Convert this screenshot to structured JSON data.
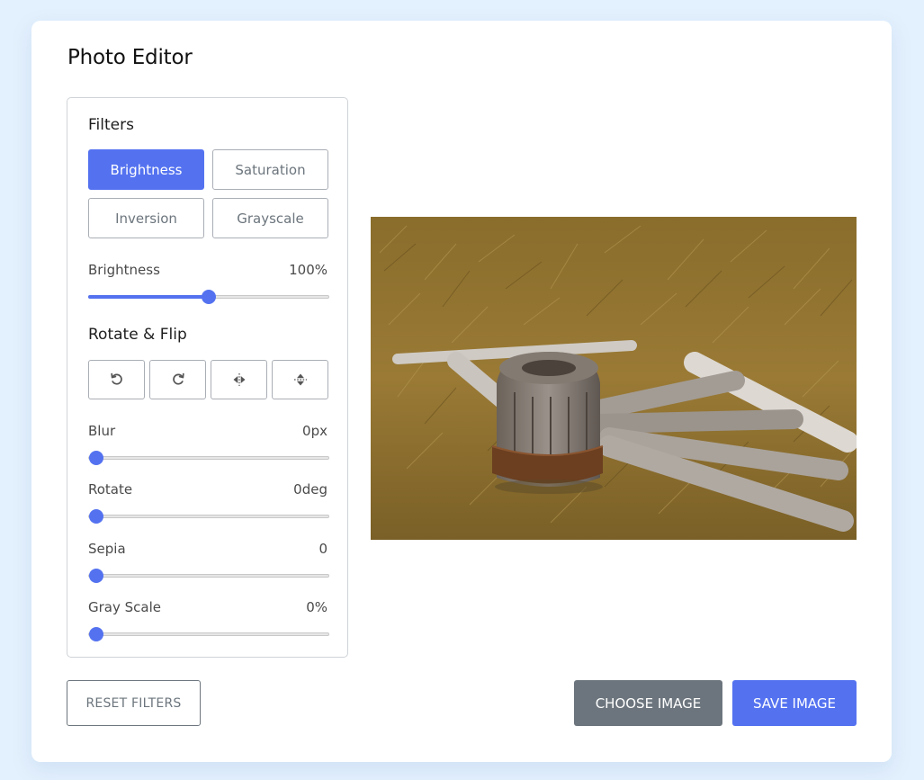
{
  "app": {
    "title": "Photo Editor"
  },
  "filters": {
    "heading": "Filters",
    "buttons": [
      {
        "label": "Brightness",
        "active": true
      },
      {
        "label": "Saturation",
        "active": false
      },
      {
        "label": "Inversion",
        "active": false
      },
      {
        "label": "Grayscale",
        "active": false
      }
    ],
    "active_slider": {
      "label": "Brightness",
      "value": "100%",
      "level_fraction": 0.5
    }
  },
  "rotate_flip": {
    "heading": "Rotate & Flip",
    "buttons": [
      "rotate-left-icon",
      "rotate-right-icon",
      "flip-horizontal-icon",
      "flip-vertical-icon"
    ]
  },
  "sliders": [
    {
      "label": "Blur",
      "value": "0px",
      "level_fraction": 0
    },
    {
      "label": "Rotate",
      "value": "0deg",
      "level_fraction": 0
    },
    {
      "label": "Sepia",
      "value": "0",
      "level_fraction": 0
    },
    {
      "label": "Gray Scale",
      "value": "0%",
      "level_fraction": 0
    }
  ],
  "actions": {
    "reset_label": "RESET FILTERS",
    "choose_label": "CHOOSE IMAGE",
    "save_label": "SAVE IMAGE"
  },
  "colors": {
    "accent": "#5472f0",
    "secondary": "#6c757d",
    "background": "#e3f0fd"
  }
}
